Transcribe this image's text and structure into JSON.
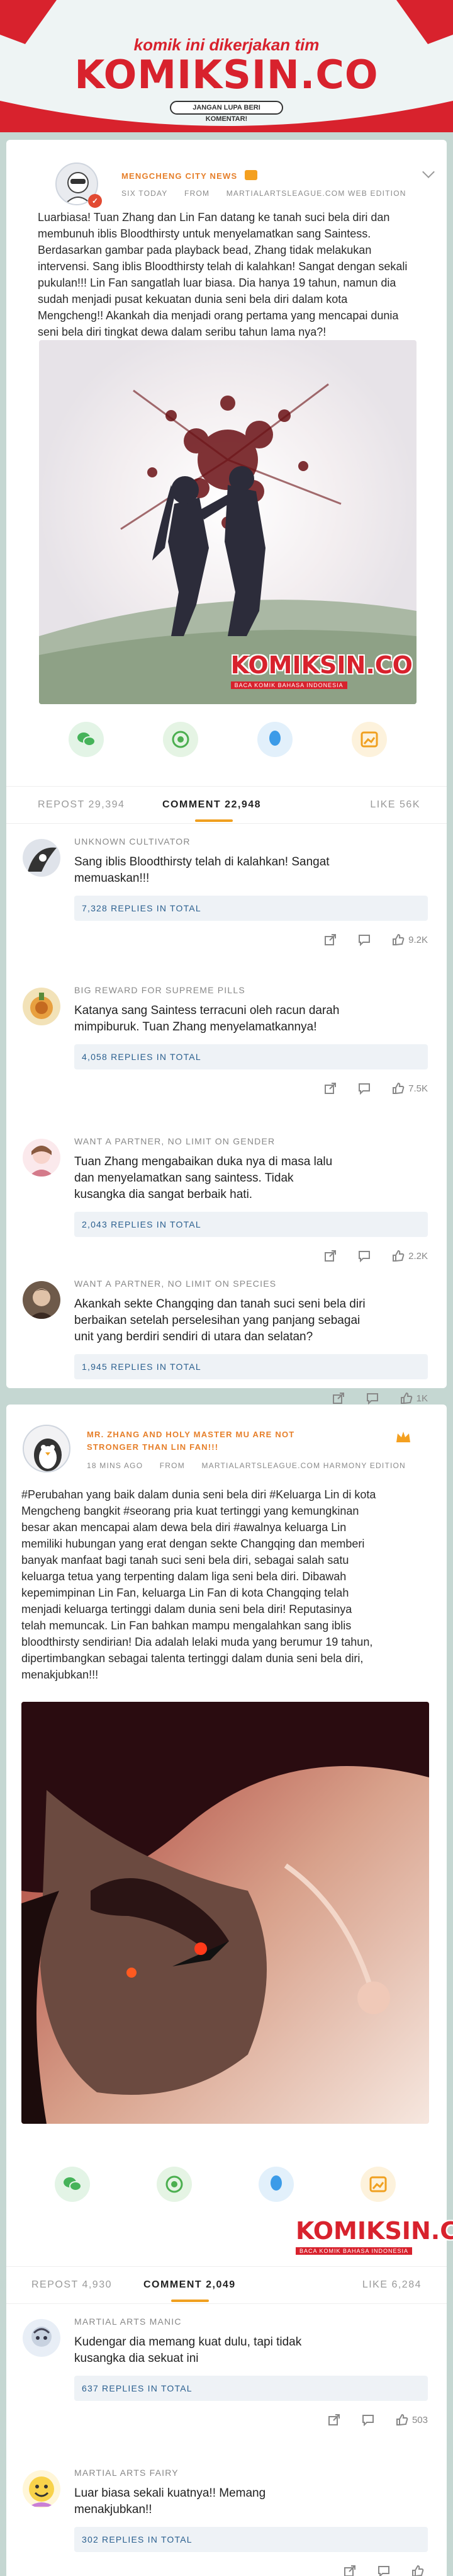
{
  "banner": {
    "top_text": "komik ini dikerjakan tim",
    "logo": "KOMIKSIN.CO",
    "sub": "JANGAN LUPA BERI KOMENTAR!"
  },
  "watermark": {
    "logo": "KOMIKSIN.CO",
    "sub": "BACA KOMIK BAHASA INDONESIA"
  },
  "post1": {
    "poster": "MENGCHENG CITY NEWS",
    "time": "SIX TODAY",
    "from": "FROM",
    "source": "MARTIALARTSLEAGUE.COM WEB EDITION",
    "lines": [
      "Luarbiasa! Tuan Zhang dan Lin Fan datang ke tanah suci bela diri dan",
      "membunuh iblis Bloodthirsty untuk menyelamatkan sang Saintess.",
      "Berdasarkan gambar pada playback bead, Zhang tidak melakukan",
      "intervensi. Sang iblis Bloodthirsty telah di kalahkan! Sangat dengan sekali",
      "pukulan!!! Lin Fan sangatlah luar biasa. Dia hanya 19 tahun, namun dia",
      "sudah menjadi pusat kekuatan dunia seni bela diri dalam kota",
      "Mengcheng!! Akankah dia menjadi orang pertama yang mencapai dunia",
      "seni bela diri tingkat dewa dalam seribu tahun lama nya?!"
    ],
    "repost_label": "REPOST",
    "repost_count": "29,394",
    "comment_label": "COMMENT",
    "comment_count": "22,948",
    "like_label": "LIKE",
    "like_count": "56K",
    "comments": [
      {
        "name": "UNKNOWN CULTIVATOR",
        "lines": [
          "Sang iblis Bloodthirsty telah di kalahkan! Sangat",
          "memuaskan!!!"
        ],
        "replies": "7,328 REPLIES IN TOTAL",
        "likes": "9.2K"
      },
      {
        "name": "BIG REWARD FOR SUPREME PILLS",
        "lines": [
          "Katanya sang Saintess terracuni oleh racun darah",
          "mimpiburuk. Tuan Zhang menyelamatkannya!"
        ],
        "replies": "4,058 REPLIES IN TOTAL",
        "likes": "7.5K"
      },
      {
        "name": "WANT A PARTNER, NO LIMIT ON GENDER",
        "lines": [
          "Tuan Zhang mengabaikan duka nya di masa lalu",
          "dan menyelamatkan sang saintess. Tidak",
          "kusangka dia sangat berbaik hati."
        ],
        "replies": "2,043 REPLIES IN TOTAL",
        "likes": "2.2K"
      },
      {
        "name": "WANT A PARTNER, NO LIMIT ON SPECIES",
        "lines": [
          "Akankah sekte Changqing dan tanah suci seni bela diri",
          "berbaikan setelah perselesihan yang panjang sebagai",
          "unit yang berdiri sendiri di utara dan selatan?"
        ],
        "replies": "1,945 REPLIES IN TOTAL",
        "likes": "1K"
      }
    ]
  },
  "post2": {
    "poster_line1": "MR. ZHANG AND HOLY MASTER MU ARE NOT",
    "poster_line2": "STRONGER THAN LIN FAN!!!",
    "time": "18 MINS AGO",
    "from": "FROM",
    "source": "MARTIALARTSLEAGUE.COM HARMONY EDITION",
    "lines": [
      "#Perubahan yang baik dalam dunia seni bela diri #Keluarga Lin di kota",
      "Mengcheng bangkit #seorang pria kuat tertinggi yang kemungkinan",
      "besar akan mencapai alam dewa bela diri #awalnya keluarga Lin",
      "memiliki hubungan yang erat dengan sekte Changqing dan memberi",
      "banyak manfaat bagi tanah suci seni bela diri, sebagai salah satu",
      "keluarga tetua yang terpenting dalam liga seni bela diri. Dibawah",
      "kepemimpinan Lin Fan, keluarga Lin Fan di kota Changqing telah",
      "menjadi keluarga tertinggi dalam dunia seni bela diri! Reputasinya",
      "telah memuncak. Lin Fan bahkan mampu mengalahkan sang iblis",
      "bloodthirsty sendirian! Dia adalah lelaki muda yang berumur 19 tahun,",
      "dipertimbangkan sebagai talenta tertinggi dalam dunia seni bela diri,",
      "menakjubkan!!!"
    ],
    "repost_label": "REPOST",
    "repost_count": "4,930",
    "comment_label": "COMMENT",
    "comment_count": "2,049",
    "like_label": "LIKE",
    "like_count": "6,284",
    "comments": [
      {
        "name": "MARTIAL ARTS MANIC",
        "lines": [
          "Kudengar dia memang kuat dulu, tapi tidak",
          "kusangka dia sekuat ini"
        ],
        "replies": "637 REPLIES IN TOTAL",
        "likes": "503"
      },
      {
        "name": "MARTIAL ARTS FAIRY",
        "lines": [
          "Luar biasa sekali kuatnya!! Memang",
          "menakjubkan!!"
        ],
        "replies": "302 REPLIES IN TOTAL",
        "likes": ""
      }
    ]
  }
}
